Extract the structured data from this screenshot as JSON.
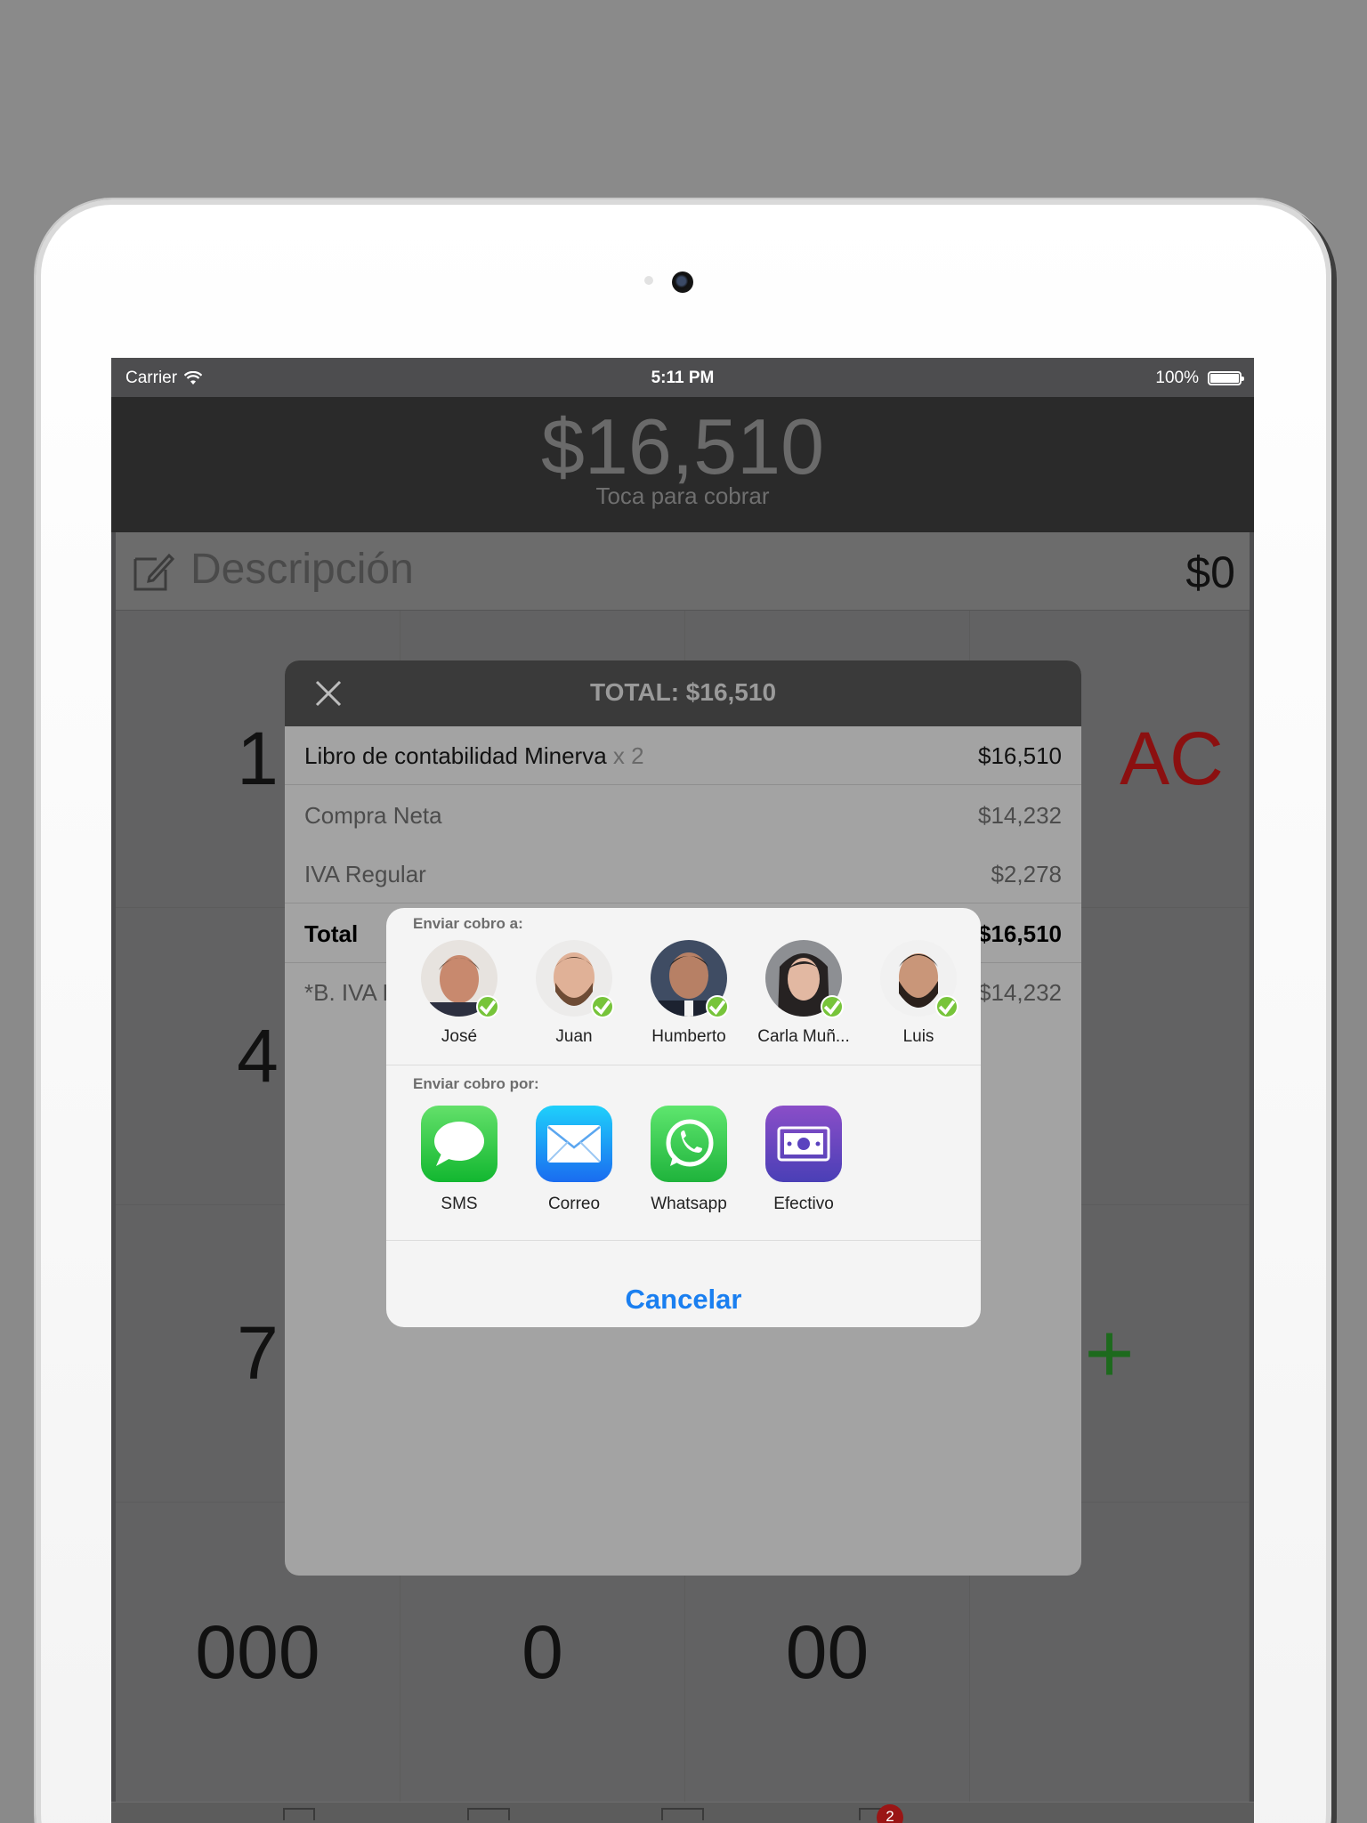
{
  "status_bar": {
    "carrier": "Carrier",
    "time": "5:11 PM",
    "battery": "100%"
  },
  "header": {
    "amount": "$16,510",
    "hint": "Toca para cobrar"
  },
  "description": {
    "placeholder": "Descripción",
    "amount": "$0"
  },
  "keypad": {
    "keys": [
      "1",
      "4",
      "7",
      "000",
      "0",
      "00",
      "AC",
      "+"
    ]
  },
  "tabbar": {
    "badge": "2"
  },
  "receipt": {
    "title": "TOTAL: $16,510",
    "item": {
      "name": "Libro de contabilidad Minerva",
      "qty": "x 2",
      "price": "$16,510"
    },
    "net": {
      "label": "Compra Neta",
      "value": "$14,232"
    },
    "tax": {
      "label": "IVA Regular",
      "value": "$2,278"
    },
    "total": {
      "label": "Total",
      "value": "$16,510"
    },
    "base": {
      "label": "*B. IVA R",
      "value": "$14,232"
    }
  },
  "share_sheet": {
    "send_to_label": "Enviar cobro a:",
    "contacts": [
      {
        "name": "José"
      },
      {
        "name": "Juan"
      },
      {
        "name": "Humberto"
      },
      {
        "name": "Carla Muñ..."
      },
      {
        "name": "Luis"
      }
    ],
    "send_via_label": "Enviar cobro por:",
    "apps": [
      {
        "name": "SMS",
        "icon": "messages-icon",
        "color": "#35c759"
      },
      {
        "name": "Correo",
        "icon": "mail-icon",
        "color": "#1e8ef5"
      },
      {
        "name": "Whatsapp",
        "icon": "whatsapp-icon",
        "color": "#2fd15a"
      },
      {
        "name": "Efectivo",
        "icon": "cash-icon",
        "color": "#6a3fc7"
      }
    ],
    "cancel": "Cancelar"
  }
}
